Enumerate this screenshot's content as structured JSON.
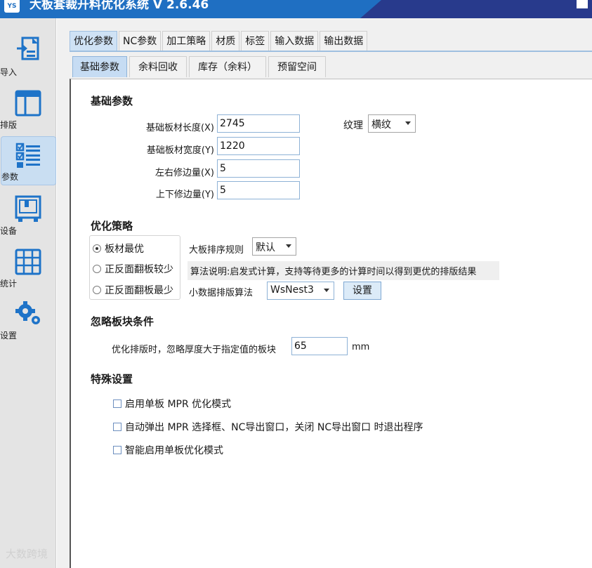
{
  "app": {
    "title": "大板套裁开料优化系统 V 2.6.46",
    "icon_text": "YS"
  },
  "sidebar": {
    "items": [
      {
        "label": "导入",
        "icon": "import-icon"
      },
      {
        "label": "排版",
        "icon": "layout-icon"
      },
      {
        "label": "参数",
        "icon": "params-icon",
        "active": true
      },
      {
        "label": "设备",
        "icon": "device-icon"
      },
      {
        "label": "统计",
        "icon": "stats-icon"
      },
      {
        "label": "设置",
        "icon": "settings-icon"
      }
    ]
  },
  "tabs": [
    {
      "label": "优化参数",
      "active": true
    },
    {
      "label": "NC参数"
    },
    {
      "label": "加工策略"
    },
    {
      "label": "材质"
    },
    {
      "label": "标签"
    },
    {
      "label": "输入数据"
    },
    {
      "label": "输出数据"
    }
  ],
  "subtabs": [
    {
      "label": "基础参数",
      "active": true
    },
    {
      "label": "余料回收"
    },
    {
      "label": "库存（余料）"
    },
    {
      "label": "预留空间"
    }
  ],
  "basic": {
    "title": "基础参数",
    "length_label": "基础板材长度(X)",
    "length_value": "2745",
    "width_label": "基础板材宽度(Y)",
    "width_value": "1220",
    "lr_trim_label": "左右修边量(X)",
    "lr_trim_value": "5",
    "tb_trim_label": "上下修边量(Y)",
    "tb_trim_value": "5",
    "texture_label": "纹理",
    "texture_value": "横纹"
  },
  "strategy": {
    "title": "优化策略",
    "options": [
      {
        "label": "板材最优",
        "selected": true
      },
      {
        "label": "正反面翻板较少",
        "selected": false
      },
      {
        "label": "正反面翻板最少",
        "selected": false
      }
    ],
    "sort_label": "大板排序规则",
    "sort_value": "默认",
    "note": "算法说明:启发式计算，支持等待更多的计算时间以得到更优的排版结果",
    "small_algo_label": "小数据排版算法",
    "small_algo_value": "WsNest3",
    "settings_button": "设置"
  },
  "ignore": {
    "title": "忽略板块条件",
    "label": "优化排版时，忽略厚度大于指定值的板块",
    "value": "65",
    "unit": "mm"
  },
  "special": {
    "title": "特殊设置",
    "options": [
      {
        "label": "启用单板 MPR 优化模式",
        "checked": false
      },
      {
        "label": "自动弹出 MPR 选择框、NC导出窗口，关闭 NC导出窗口 时退出程序",
        "checked": false
      },
      {
        "label": "智能启用单板优化模式",
        "checked": false
      }
    ]
  },
  "watermark": "大数跨境",
  "colors": {
    "titlebar": "#1f6fc2",
    "titlebar_dark": "#283a8c",
    "accent": "#2a7fd4",
    "active_tab": "#cfe2f5"
  }
}
